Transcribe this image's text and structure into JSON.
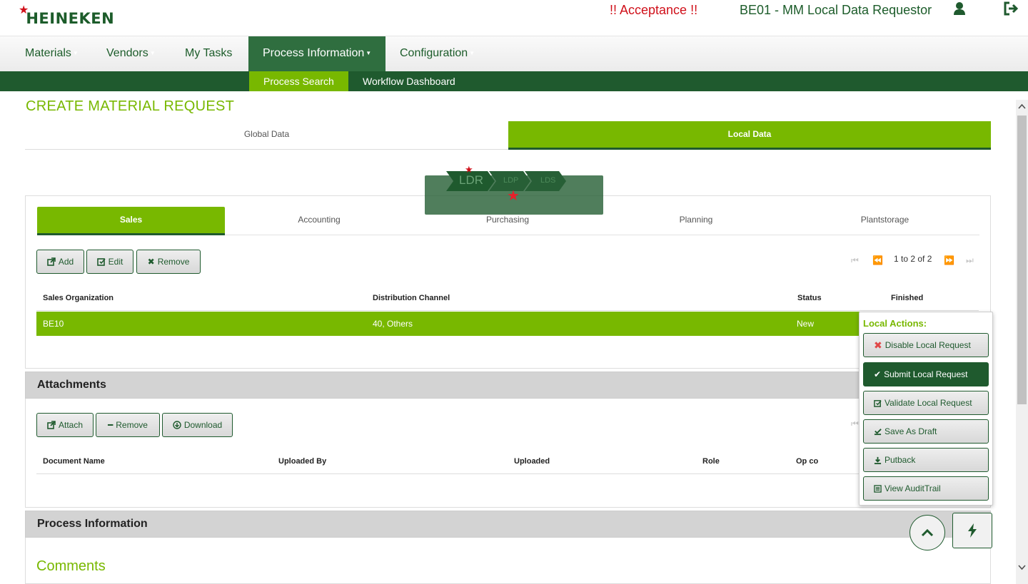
{
  "header": {
    "logo_text": "HEINEKEN",
    "environment": "!! Acceptance !!",
    "role": "BE01 - MM Local Data Requestor",
    "user_icon": "user-icon",
    "logout_icon": "logout-icon"
  },
  "menu": {
    "items": [
      {
        "label": "Materials"
      },
      {
        "label": "Vendors"
      },
      {
        "label": "My Tasks"
      },
      {
        "label": "Process Information"
      },
      {
        "label": "Configuration"
      }
    ],
    "active": "Process Information",
    "submenu": [
      {
        "label": "Process Search"
      },
      {
        "label": "Workflow Dashboard"
      }
    ]
  },
  "page": {
    "title": "CREATE MATERIAL REQUEST",
    "top_tabs": [
      {
        "label": "Global Data"
      },
      {
        "label": "Local Data"
      }
    ],
    "active_top_tab": "Local Data"
  },
  "workflow": {
    "steps": [
      "LDR",
      "LDP",
      "LDS"
    ],
    "current": "LDR"
  },
  "sales_panel": {
    "tabs": [
      {
        "label": "Sales"
      },
      {
        "label": "Accounting"
      },
      {
        "label": "Purchasing"
      },
      {
        "label": "Planning"
      },
      {
        "label": "Plantstorage"
      }
    ],
    "active_tab": "Sales",
    "buttons": {
      "add": "Add",
      "edit": "Edit",
      "remove": "Remove"
    },
    "pager_text": "1 to 2 of 2",
    "columns": [
      "Sales Organization",
      "Distribution Channel",
      "Status",
      "Finished"
    ],
    "rows": [
      {
        "sales_org": "BE10",
        "channel": "40, Others",
        "status": "New",
        "finished": ""
      }
    ]
  },
  "attachments": {
    "title": "Attachments",
    "buttons": {
      "attach": "Attach",
      "remove": "Remove",
      "download": "Download"
    },
    "columns": [
      "Document Name",
      "Uploaded By",
      "Uploaded",
      "Role",
      "Op co"
    ]
  },
  "process_info": {
    "title": "Process Information",
    "comments_title": "Comments"
  },
  "local_actions": {
    "title": "Local Actions:",
    "buttons": [
      {
        "label": "Disable Local Request",
        "icon": "x-red-icon"
      },
      {
        "label": "Submit Local Request",
        "icon": "check-icon"
      },
      {
        "label": "Validate Local Request",
        "icon": "check-square-icon"
      },
      {
        "label": "Save As Draft",
        "icon": "save-icon"
      },
      {
        "label": "Putback",
        "icon": "download-icon"
      },
      {
        "label": "View AuditTrail",
        "icon": "list-icon"
      }
    ]
  },
  "colors": {
    "brand_dark_green": "#1f5a2e",
    "accent_green": "#78b800",
    "alert_red": "#d0101a"
  }
}
